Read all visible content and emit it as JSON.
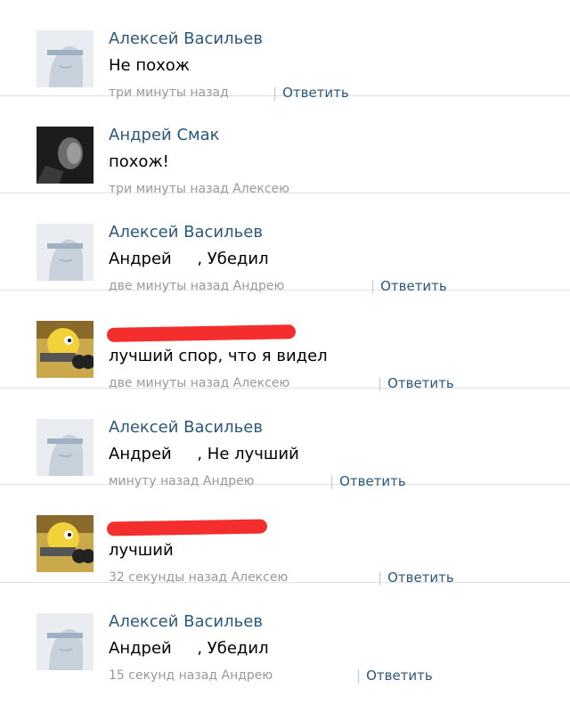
{
  "comments": [
    {
      "author": "Алексей Васильев",
      "text": "Не похож",
      "meta": "три минуты назад",
      "reply": "Ответить",
      "avatar": "vk-default-avatar-icon"
    },
    {
      "author": "Андрей Смак",
      "text": "похож!",
      "meta": "три минуты назад Алексею",
      "reply": "",
      "avatar": "dark-portrait-avatar-icon"
    },
    {
      "author": "Алексей Васильев",
      "text": "Андрей     , Убедил",
      "meta": "две минуты назад Андрею",
      "reply": "Ответить",
      "avatar": "vk-default-avatar-icon"
    },
    {
      "author": "",
      "text": "лучший спор, что я видел",
      "meta": "две минуты назад Алексею",
      "reply": "Ответить",
      "avatar": "homer-with-gun-avatar-icon"
    },
    {
      "author": "Алексей Васильев",
      "text": "Андрей     , Не лучший",
      "meta": "минуту назад Андрею",
      "reply": "Ответить",
      "avatar": "vk-default-avatar-icon"
    },
    {
      "author": "",
      "text": "лучший",
      "meta": "32 секунды назад Алексею",
      "reply": "Ответить",
      "avatar": "homer-with-gun-avatar-icon"
    },
    {
      "author": "Алексей Васильев",
      "text": "Андрей     , Убедил",
      "meta": "15 секунд назад Андрею",
      "reply": "Ответить",
      "avatar": "vk-default-avatar-icon"
    }
  ],
  "colors": {
    "link": "#2b587a",
    "meta": "#999999",
    "redaction": "#f42d2d"
  }
}
